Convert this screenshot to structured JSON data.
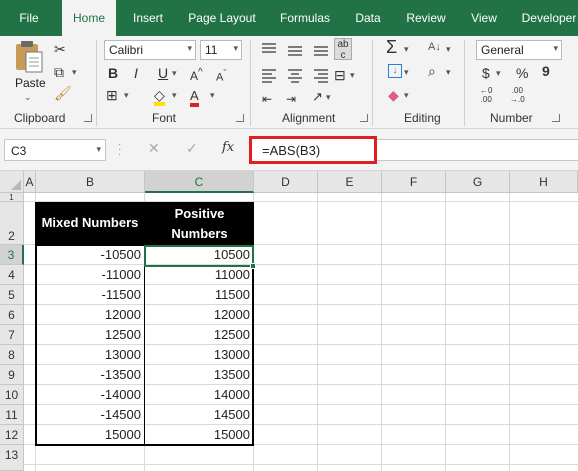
{
  "tabs": [
    "File",
    "Home",
    "Insert",
    "Page Layout",
    "Formulas",
    "Data",
    "Review",
    "View",
    "Developer"
  ],
  "ribbon": {
    "clipboard": {
      "paste_label": "Paste",
      "group_label": "Clipboard"
    },
    "font": {
      "font_name": "Calibri",
      "font_size": "11",
      "bold": "B",
      "italic": "I",
      "underline": "U",
      "group_label": "Font"
    },
    "alignment": {
      "group_label": "Alignment"
    },
    "editing": {
      "group_label": "Editing"
    },
    "number": {
      "format": "General",
      "currency": "$",
      "percent": "%",
      "comma": "9",
      "group_label": "Number"
    }
  },
  "formula_bar": {
    "name_box": "C3",
    "fx": "fx",
    "formula": "=ABS(B3)"
  },
  "grid": {
    "columns": [
      "A",
      "B",
      "C",
      "D",
      "E",
      "F",
      "G",
      "H"
    ],
    "selected_column": "C",
    "rows": [
      "1",
      "2",
      "3",
      "4",
      "5",
      "6",
      "7",
      "8",
      "9",
      "10",
      "11",
      "12",
      "13"
    ],
    "selected_row": "3",
    "header_b": "Mixed Numbers",
    "header_c_line1": "Positive",
    "header_c_line2": "Numbers",
    "mixed": [
      "-10500",
      "-11000",
      "-11500",
      "12000",
      "12500",
      "13000",
      "-13500",
      "-14000",
      "-14500",
      "15000"
    ],
    "positive": [
      "10500",
      "11000",
      "11500",
      "12000",
      "12500",
      "13000",
      "13500",
      "14000",
      "14500",
      "15000"
    ]
  }
}
